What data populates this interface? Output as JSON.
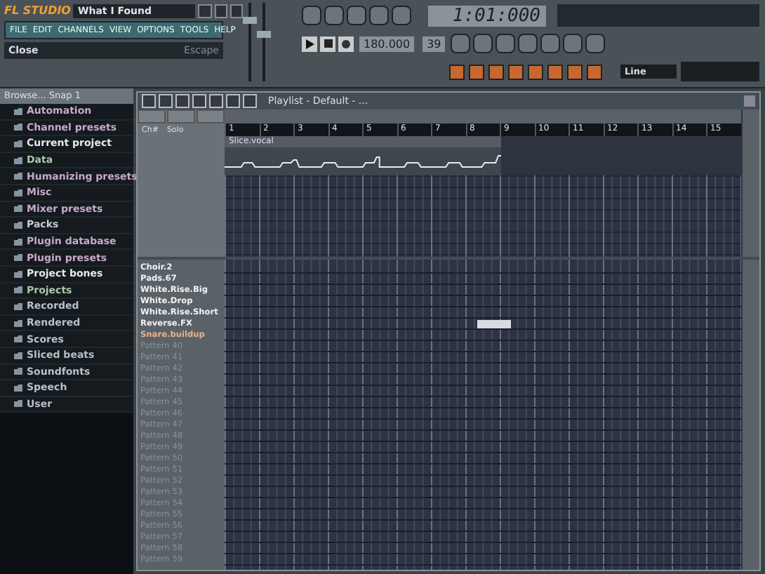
{
  "app": {
    "logo": "FL STUDIO",
    "title": "What I Found",
    "menu": [
      "FILE",
      "EDIT",
      "CHANNELS",
      "VIEW",
      "OPTIONS",
      "TOOLS",
      "HELP"
    ],
    "hint": {
      "text": "Close",
      "shortcut": "Escape"
    }
  },
  "mixer": {
    "volume": {
      "level": 0.8
    },
    "pitch": {
      "level": 0.6
    }
  },
  "transport": {
    "time": "1:01:000",
    "tempo": "180.000",
    "pattern": "39"
  },
  "snap": {
    "value": "Line"
  },
  "browser": {
    "title": "Browse... Snap 1",
    "items": [
      {
        "label": "Automation",
        "color": "#c8a8cc"
      },
      {
        "label": "Channel presets",
        "color": "#c8a8cc"
      },
      {
        "label": "Current project",
        "color": "#e8e8ec"
      },
      {
        "label": "Data",
        "color": "#a8c8a8"
      },
      {
        "label": "Humanizing presets",
        "color": "#c8a8cc"
      },
      {
        "label": "Misc",
        "color": "#c8a8cc"
      },
      {
        "label": "Mixer presets",
        "color": "#c8a8cc"
      },
      {
        "label": "Packs",
        "color": "#c4ccd4"
      },
      {
        "label": "Plugin database",
        "color": "#c8a8cc"
      },
      {
        "label": "Plugin presets",
        "color": "#c8a8cc"
      },
      {
        "label": "Project bones",
        "color": "#e8e8ec"
      },
      {
        "label": "Projects",
        "color": "#a8c8a8"
      },
      {
        "label": "Recorded",
        "color": "#b8c0c8"
      },
      {
        "label": "Rendered",
        "color": "#b8c0c8"
      },
      {
        "label": "Scores",
        "color": "#b8c0c8"
      },
      {
        "label": "Sliced beats",
        "color": "#b8c0c8"
      },
      {
        "label": "Soundfonts",
        "color": "#b8c0c8"
      },
      {
        "label": "Speech",
        "color": "#b8c0c8"
      },
      {
        "label": "User",
        "color": "#b8c0c8"
      }
    ]
  },
  "playlist": {
    "title": "Playlist - Default - ...",
    "labels": [
      "Ch#",
      "Solo"
    ],
    "ruler": [
      "1",
      "2",
      "3",
      "4",
      "5",
      "6",
      "7",
      "8",
      "9",
      "10",
      "11",
      "12",
      "13",
      "14",
      "15"
    ],
    "clip": {
      "name": "Slice.vocal"
    },
    "tracks": [
      {
        "name": "Choir.2",
        "selected": false,
        "empty": false,
        "has_clip": false
      },
      {
        "name": "Pads.67",
        "selected": false,
        "empty": false,
        "has_clip": false
      },
      {
        "name": "White.Rise.Big",
        "selected": false,
        "empty": false,
        "has_clip": false
      },
      {
        "name": "White.Drop",
        "selected": false,
        "empty": false,
        "has_clip": false
      },
      {
        "name": "White.Rise.Short",
        "selected": false,
        "empty": false,
        "has_clip": false
      },
      {
        "name": "Reverse.FX",
        "selected": false,
        "empty": false,
        "has_clip": true
      },
      {
        "name": "Snare.buildup",
        "selected": true,
        "empty": false,
        "has_clip": false
      },
      {
        "name": "Pattern 40",
        "selected": false,
        "empty": true,
        "has_clip": false
      },
      {
        "name": "Pattern 41",
        "selected": false,
        "empty": true,
        "has_clip": false
      },
      {
        "name": "Pattern 42",
        "selected": false,
        "empty": true,
        "has_clip": false
      },
      {
        "name": "Pattern 43",
        "selected": false,
        "empty": true,
        "has_clip": false
      },
      {
        "name": "Pattern 44",
        "selected": false,
        "empty": true,
        "has_clip": false
      },
      {
        "name": "Pattern 45",
        "selected": false,
        "empty": true,
        "has_clip": false
      },
      {
        "name": "Pattern 46",
        "selected": false,
        "empty": true,
        "has_clip": false
      },
      {
        "name": "Pattern 47",
        "selected": false,
        "empty": true,
        "has_clip": false
      },
      {
        "name": "Pattern 48",
        "selected": false,
        "empty": true,
        "has_clip": false
      },
      {
        "name": "Pattern 49",
        "selected": false,
        "empty": true,
        "has_clip": false
      },
      {
        "name": "Pattern 50",
        "selected": false,
        "empty": true,
        "has_clip": false
      },
      {
        "name": "Pattern 51",
        "selected": false,
        "empty": true,
        "has_clip": false
      },
      {
        "name": "Pattern 52",
        "selected": false,
        "empty": true,
        "has_clip": false
      },
      {
        "name": "Pattern 53",
        "selected": false,
        "empty": true,
        "has_clip": false
      },
      {
        "name": "Pattern 54",
        "selected": false,
        "empty": true,
        "has_clip": false
      },
      {
        "name": "Pattern 55",
        "selected": false,
        "empty": true,
        "has_clip": false
      },
      {
        "name": "Pattern 56",
        "selected": false,
        "empty": true,
        "has_clip": false
      },
      {
        "name": "Pattern 57",
        "selected": false,
        "empty": true,
        "has_clip": false
      },
      {
        "name": "Pattern 58",
        "selected": false,
        "empty": true,
        "has_clip": false
      },
      {
        "name": "Pattern 59",
        "selected": false,
        "empty": true,
        "has_clip": false
      }
    ]
  }
}
